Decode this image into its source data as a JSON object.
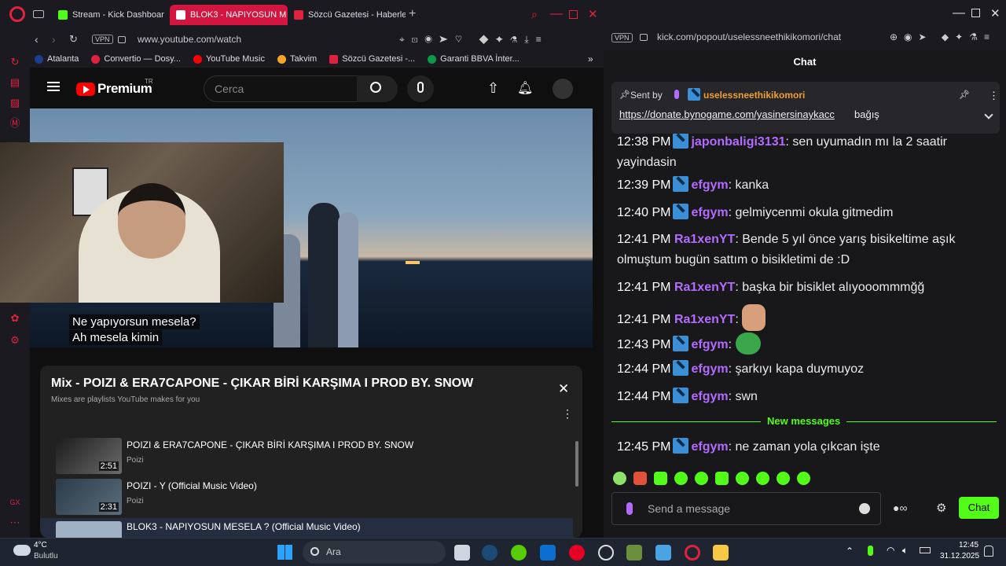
{
  "browser_left": {
    "tabs": [
      {
        "label": "Stream - Kick Dashboar"
      },
      {
        "label": "BLOK3 - NAPIYOSUN M"
      },
      {
        "label": "Sözcü Gazetesi - Haberler"
      }
    ],
    "vpn": "VPN",
    "url": "www.youtube.com/watch",
    "bookmarks": [
      "Atalanta",
      "Convertio — Dosy...",
      "YouTube Music",
      "Takvim",
      "Sözcü Gazetesi -...",
      "Garanti BBVA İnter..."
    ]
  },
  "youtube": {
    "logo": "Premium",
    "logo_sup": "TR",
    "search_placeholder": "Cerca",
    "subtitles": [
      "Ne yapıyorsun mesela?",
      "Ah mesela kimin"
    ],
    "playlist": {
      "title": "Mix - POIZI & ERA7CAPONE - ÇIKAR BİRİ KARŞIMA I PROD BY. SNOW",
      "subtitle": "Mixes are playlists YouTube makes for you",
      "items": [
        {
          "title": "POIZI & ERA7CAPONE - ÇIKAR BİRİ KARŞIMA I PROD BY. SNOW",
          "author": "Poizi",
          "duration": "2:51"
        },
        {
          "title": "POIZI - Y (Official Music Video)",
          "author": "Poizi",
          "duration": "2:31"
        },
        {
          "title": "BLOK3 - NAPIYOSUN MESELA ? (Official Music Video)",
          "author": "",
          "duration": ""
        }
      ]
    }
  },
  "browser_right": {
    "vpn": "VPN",
    "url": "kick.com/popout/uselessneethikikomori/chat"
  },
  "chat": {
    "header": "Chat",
    "pinned": {
      "sent_by": "Sent by",
      "user": "uselessneethikikomori",
      "text": "https://donate.bynogame.com/yasinersinaykacc",
      "suffix": "bağış"
    },
    "partial_top": {
      "time": "12:38 PM",
      "user": "japonbaligi3131",
      "text": "sen uyumadın mı la 2 saatir yayindasin"
    },
    "messages": [
      {
        "time": "12:39 PM",
        "user": "efgym",
        "text": "kanka"
      },
      {
        "time": "12:40 PM",
        "user": "efgym",
        "text": "gelmiycenmi okula gitmedim"
      },
      {
        "time": "12:41 PM",
        "user": "Ra1xenYT",
        "text": "Bende 5 yıl önce yarış bisikeltime aşık olmuştum bugün sattım o bisikletimi de :D"
      },
      {
        "time": "12:41 PM",
        "user": "Ra1xenYT",
        "text": "başka bir bisiklet alıyooommmğğ"
      },
      {
        "time": "12:41 PM",
        "user": "Ra1xenYT",
        "text": ""
      },
      {
        "time": "12:43 PM",
        "user": "efgym",
        "text": ""
      },
      {
        "time": "12:44 PM",
        "user": "efgym",
        "text": "şarkıyı kapa duymuyoz"
      },
      {
        "time": "12:44 PM",
        "user": "efgym",
        "text": "swn"
      }
    ],
    "new_messages": "New messages",
    "last": {
      "time": "12:45 PM",
      "user": "efgym",
      "text": "ne zaman yola çıkcan işte"
    },
    "input_placeholder": "Send a message",
    "send": "Chat"
  },
  "taskbar": {
    "weather_temp": "4°C",
    "weather_desc": "Bulutlu",
    "search": "Ara",
    "time": "12:45",
    "date": "31.12.2025"
  }
}
